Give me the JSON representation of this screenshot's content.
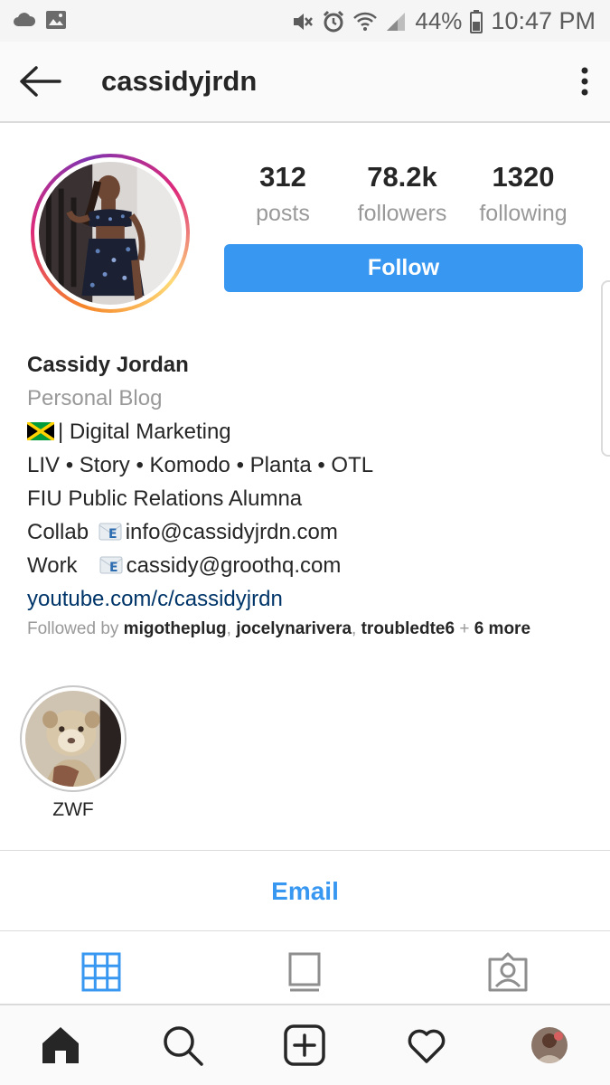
{
  "status_bar": {
    "battery": "44%",
    "time": "10:47 PM",
    "icons": [
      "cloud-icon",
      "image-icon",
      "mute-icon",
      "alarm-icon",
      "wifi-icon",
      "signal-icon",
      "battery-icon"
    ]
  },
  "header": {
    "username": "cassidyjrdn",
    "icons": [
      "back-arrow-icon",
      "more-vertical-icon"
    ]
  },
  "profile": {
    "stats": [
      {
        "value": "312",
        "label": "posts"
      },
      {
        "value": "78.2k",
        "label": "followers"
      },
      {
        "value": "1320",
        "label": "following"
      }
    ],
    "follow_label": "Follow",
    "name": "Cassidy Jordan",
    "category": "Personal Blog",
    "bio_line1": "| Digital Marketing",
    "bio_line2": "LIV • Story • Komodo • Planta • OTL",
    "bio_line3": "FIU Public Relations Alumna",
    "collab_label": "Collab",
    "collab_email": "info@cassidyjrdn.com",
    "work_label": "Work",
    "work_email": "cassidy@groothq.com",
    "website": "youtube.com/c/cassidyjrdn",
    "followed_by_prefix": "Followed by",
    "followed_by": [
      "migotheplug",
      "jocelynarivera",
      "troubledte6"
    ],
    "followed_more": "6 more",
    "accent_color": "#3897f0"
  },
  "highlights": [
    {
      "label": "ZWF"
    }
  ],
  "actions": {
    "email_label": "Email"
  },
  "tabs": [
    "grid-icon",
    "feed-list-icon",
    "tagged-icon"
  ],
  "bottom_nav": [
    "home-icon",
    "search-icon",
    "add-post-icon",
    "heart-icon",
    "profile-avatar"
  ]
}
